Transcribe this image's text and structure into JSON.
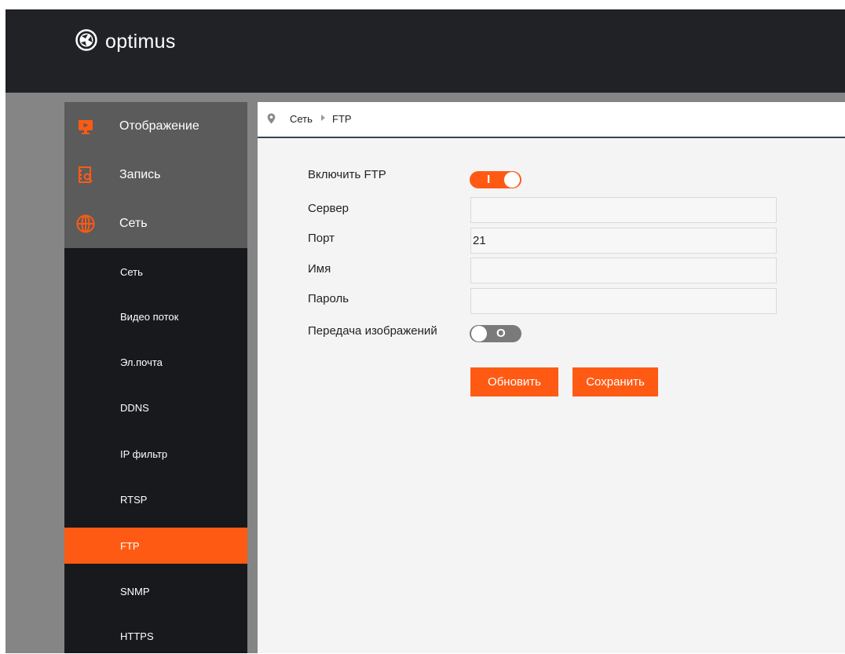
{
  "brand": {
    "name": "optimus"
  },
  "sidebar": {
    "main_items": [
      {
        "label": "Отображение",
        "icon": "monitor-play-icon"
      },
      {
        "label": "Запись",
        "icon": "record-search-icon"
      },
      {
        "label": "Сеть",
        "icon": "globe-icon"
      }
    ],
    "sub_items": [
      {
        "label": "Сеть"
      },
      {
        "label": "Видео поток"
      },
      {
        "label": "Эл.почта"
      },
      {
        "label": "DDNS"
      },
      {
        "label": "IP фильтр"
      },
      {
        "label": "RTSP"
      },
      {
        "label": "FTP",
        "active": true
      },
      {
        "label": "SNMP"
      },
      {
        "label": "HTTPS"
      }
    ]
  },
  "breadcrumb": {
    "section": "Сеть",
    "page": "FTP"
  },
  "form": {
    "enable_ftp": {
      "label": "Включить FTP",
      "state": "on",
      "text": "I"
    },
    "server": {
      "label": "Сервер",
      "value": ""
    },
    "port": {
      "label": "Порт",
      "value": "21"
    },
    "name": {
      "label": "Имя",
      "value": ""
    },
    "password": {
      "label": "Пароль",
      "value": ""
    },
    "image_transfer": {
      "label": "Передача изображений",
      "state": "off",
      "text": "O"
    }
  },
  "buttons": {
    "refresh": "Обновить",
    "save": "Сохранить"
  },
  "colors": {
    "accent": "#ff5a14",
    "header": "#202226",
    "sidebar": "#17191c",
    "sidebar_top": "#5b5b5b",
    "content_bg": "#f4f4f4"
  }
}
